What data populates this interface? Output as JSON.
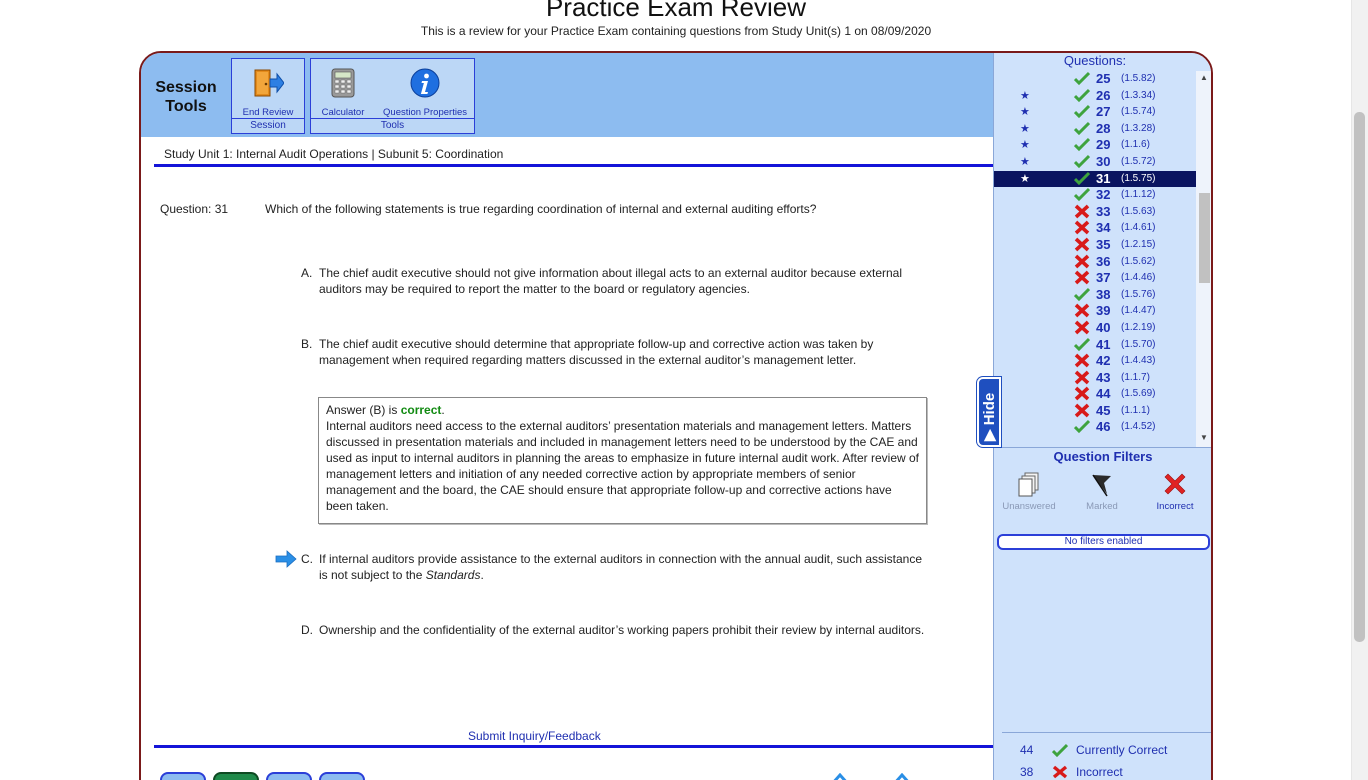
{
  "header": {
    "title": "Practice Exam Review",
    "subtitle": "This is a review for your Practice Exam containing questions from Study Unit(s) 1 on 08/09/2020"
  },
  "tools": {
    "title_line1": "Session",
    "title_line2": "Tools",
    "session_group_label": "Session",
    "tools_group_label": "Tools",
    "end_review_label": "End Review",
    "calculator_label": "Calculator",
    "question_properties_label": "Question Properties"
  },
  "study_unit": "Study Unit 1: Internal Audit Operations | Subunit 5: Coordination",
  "question": {
    "number_label": "Question: 31",
    "text": "Which of the following statements is true regarding coordination of internal and external auditing efforts?",
    "choices": [
      {
        "letter": "A.",
        "text": "The chief audit executive should not give information about illegal acts to an external auditor because external auditors may be required to report the matter to the board or regulatory agencies."
      },
      {
        "letter": "B.",
        "text": "The chief audit executive should determine that appropriate follow-up and corrective action was taken by management when required regarding matters discussed in the external auditor’s management letter."
      },
      {
        "letter": "C.",
        "text_before": "If internal auditors provide assistance to the external auditors in connection with the annual audit, such assistance is not subject to the ",
        "text_italic": "Standards",
        "text_after": "."
      },
      {
        "letter": "D.",
        "text": "Ownership and the confidentiality of the external auditor’s working papers prohibit their review by internal auditors."
      }
    ],
    "answer": {
      "prefix": "Answer (B) is ",
      "correct_word": "correct",
      "suffix": ".",
      "explanation": "Internal auditors need access to the external auditors’ presentation materials and management letters. Matters discussed in presentation materials and included in management letters need to be understood by the CAE and used as input to internal auditors in planning the areas to emphasize in future internal audit work. After review of management letters and initiation of any needed corrective action by appropriate members of senior management and the board, the CAE should ensure that appropriate follow-up and corrective actions have been taken."
    }
  },
  "inquiry_link": "Submit Inquiry/Feedback",
  "hide_tab": "Hide",
  "questions_panel": {
    "header": "Questions:",
    "items": [
      {
        "num": "25",
        "code": "(1.5.82)",
        "status": "correct",
        "starred": false,
        "current": false
      },
      {
        "num": "26",
        "code": "(1.3.34)",
        "status": "correct",
        "starred": true,
        "current": false
      },
      {
        "num": "27",
        "code": "(1.5.74)",
        "status": "correct",
        "starred": true,
        "current": false
      },
      {
        "num": "28",
        "code": "(1.3.28)",
        "status": "correct",
        "starred": true,
        "current": false
      },
      {
        "num": "29",
        "code": "(1.1.6)",
        "status": "correct",
        "starred": true,
        "current": false
      },
      {
        "num": "30",
        "code": "(1.5.72)",
        "status": "correct",
        "starred": true,
        "current": false
      },
      {
        "num": "31",
        "code": "(1.5.75)",
        "status": "correct",
        "starred": true,
        "current": true
      },
      {
        "num": "32",
        "code": "(1.1.12)",
        "status": "correct",
        "starred": false,
        "current": false
      },
      {
        "num": "33",
        "code": "(1.5.63)",
        "status": "incorrect",
        "starred": false,
        "current": false
      },
      {
        "num": "34",
        "code": "(1.4.61)",
        "status": "incorrect",
        "starred": false,
        "current": false
      },
      {
        "num": "35",
        "code": "(1.2.15)",
        "status": "incorrect",
        "starred": false,
        "current": false
      },
      {
        "num": "36",
        "code": "(1.5.62)",
        "status": "incorrect",
        "starred": false,
        "current": false
      },
      {
        "num": "37",
        "code": "(1.4.46)",
        "status": "incorrect",
        "starred": false,
        "current": false
      },
      {
        "num": "38",
        "code": "(1.5.76)",
        "status": "correct",
        "starred": false,
        "current": false
      },
      {
        "num": "39",
        "code": "(1.4.47)",
        "status": "incorrect",
        "starred": false,
        "current": false
      },
      {
        "num": "40",
        "code": "(1.2.19)",
        "status": "incorrect",
        "starred": false,
        "current": false
      },
      {
        "num": "41",
        "code": "(1.5.70)",
        "status": "correct",
        "starred": false,
        "current": false
      },
      {
        "num": "42",
        "code": "(1.4.43)",
        "status": "incorrect",
        "starred": false,
        "current": false
      },
      {
        "num": "43",
        "code": "(1.1.7)",
        "status": "incorrect",
        "starred": false,
        "current": false
      },
      {
        "num": "44",
        "code": "(1.5.69)",
        "status": "incorrect",
        "starred": false,
        "current": false
      },
      {
        "num": "45",
        "code": "(1.1.1)",
        "status": "incorrect",
        "starred": false,
        "current": false
      },
      {
        "num": "46",
        "code": "(1.4.52)",
        "status": "correct",
        "starred": false,
        "current": false
      }
    ]
  },
  "filters": {
    "title": "Question Filters",
    "unanswered_label": "Unanswered",
    "marked_label": "Marked",
    "incorrect_label": "Incorrect",
    "status": "No filters enabled"
  },
  "score": {
    "correct_count": "44",
    "correct_label": "Currently Correct",
    "incorrect_count": "38",
    "incorrect_label": "Incorrect"
  },
  "colors": {
    "tools_bar": "#8dbcf0",
    "panel_bg": "#cfe2fb",
    "accent_blue": "#1414d8",
    "correct_green": "#118a11",
    "incorrect_red": "#d81a1a"
  }
}
